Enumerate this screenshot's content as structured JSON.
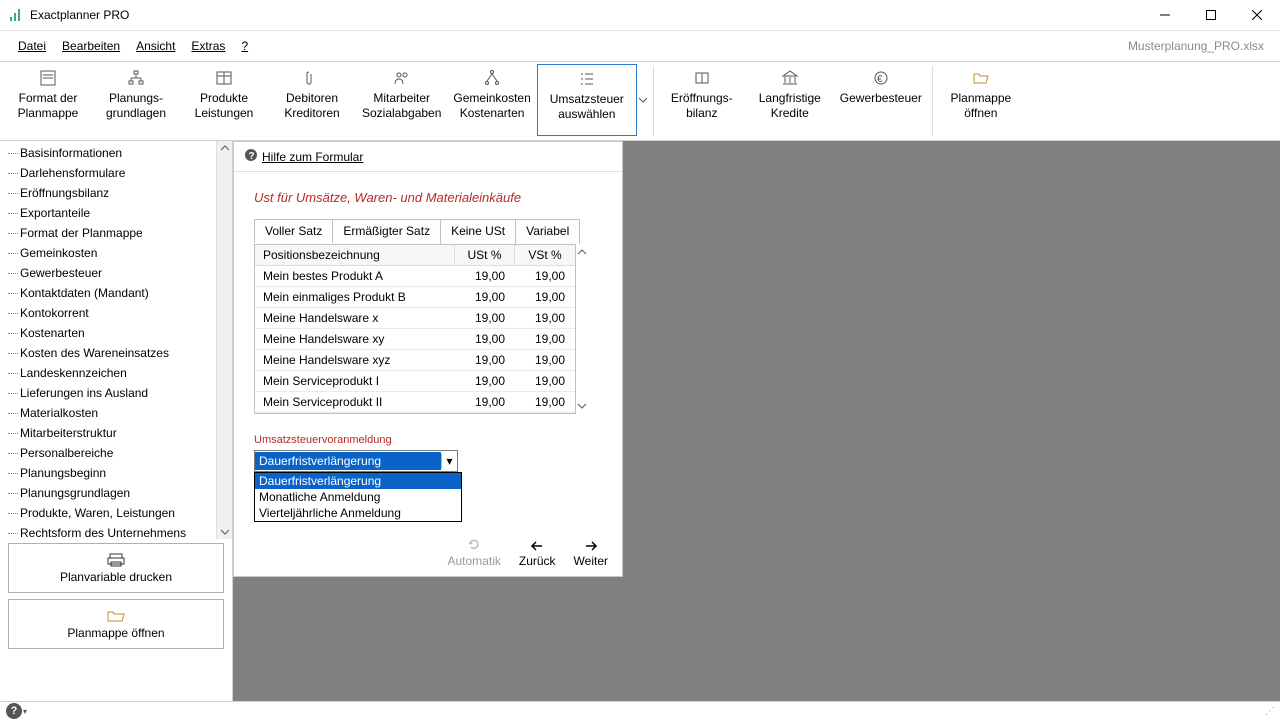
{
  "app": {
    "title": "Exactplanner PRO",
    "file_right": "Musterplanung_PRO.xlsx"
  },
  "menu": {
    "datei": "Datei",
    "bearbeiten": "Bearbeiten",
    "ansicht": "Ansicht",
    "extras": "Extras",
    "help": "?"
  },
  "ribbon": {
    "format": "Format der\nPlanmappe",
    "grundlagen": "Planungs-\ngrundlagen",
    "produkte": "Produkte\nLeistungen",
    "debitoren": "Debitoren\nKreditoren",
    "mitarbeiter": "Mitarbeiter\nSozialabgaben",
    "gemeink": "Gemeinkosten\nKostenarten",
    "ust": "Umsatzsteuer\nauswählen",
    "eroeff": "Eröffnungs-\nbilanz",
    "kredite": "Langfristige\nKredite",
    "gewerbe": "Gewerbesteuer",
    "oeffnen": "Planmappe\nöffnen"
  },
  "tree": [
    "Basisinformationen",
    "Darlehensformulare",
    "Eröffnungsbilanz",
    "Exportanteile",
    "Format der Planmappe",
    "Gemeinkosten",
    "Gewerbesteuer",
    "Kontaktdaten (Mandant)",
    "Kontokorrent",
    "Kostenarten",
    "Kosten des Wareneinsatzes",
    "Landeskennzeichen",
    "Lieferungen ins Ausland",
    "Materialkosten",
    "Mitarbeiterstruktur",
    "Personalbereiche",
    "Planungsbeginn",
    "Planungsgrundlagen",
    "Produkte, Waren, Leistungen",
    "Rechtsform des Unternehmens"
  ],
  "sidebar_buttons": {
    "print": "Planvariable drucken",
    "open": "Planmappe öffnen"
  },
  "form": {
    "help_link": "Hilfe zum Formular",
    "heading": "Ust für Umsätze, Waren- und Materialeinkäufe",
    "tabs": [
      "Voller Satz",
      "Ermäßigter Satz",
      "Keine USt",
      "Variabel"
    ],
    "header_name": "Positionsbezeichnung",
    "header_ust": "USt %",
    "header_vst": "VSt %",
    "rows": [
      {
        "name": "Mein bestes Produkt A",
        "ust": "19,00",
        "vst": "19,00"
      },
      {
        "name": "Mein einmaliges Produkt B",
        "ust": "19,00",
        "vst": "19,00"
      },
      {
        "name": "Meine Handelsware x",
        "ust": "19,00",
        "vst": "19,00"
      },
      {
        "name": "Meine Handelsware xy",
        "ust": "19,00",
        "vst": "19,00"
      },
      {
        "name": "Meine Handelsware xyz",
        "ust": "19,00",
        "vst": "19,00"
      },
      {
        "name": "Mein Serviceprodukt I",
        "ust": "19,00",
        "vst": "19,00"
      },
      {
        "name": "Mein Serviceprodukt II",
        "ust": "19,00",
        "vst": "19,00"
      }
    ],
    "sub_label": "Umsatzsteuervoranmeldung",
    "combo_selected": "Dauerfristverlängerung",
    "combo_options": [
      "Dauerfristverlängerung",
      "Monatliche Anmeldung",
      "Vierteljährliche Anmeldung"
    ],
    "footer": {
      "auto": "Automatik",
      "back": "Zurück",
      "next": "Weiter"
    }
  }
}
